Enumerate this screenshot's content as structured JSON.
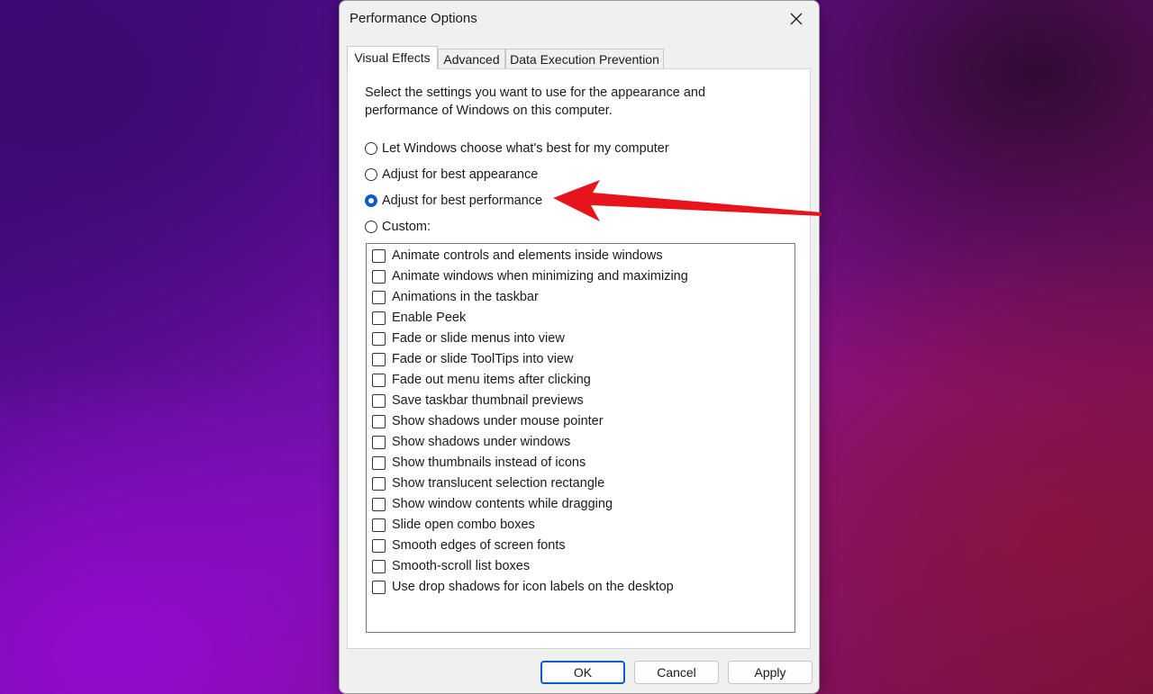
{
  "dialog": {
    "title": "Performance Options",
    "close_icon": "close-icon"
  },
  "tabs": [
    {
      "label": "Visual Effects",
      "active": true
    },
    {
      "label": "Advanced",
      "active": false
    },
    {
      "label": "Data Execution Prevention",
      "active": false
    }
  ],
  "visual_effects": {
    "intro": "Select the settings you want to use for the appearance and performance of Windows on this computer.",
    "options": [
      {
        "label": "Let Windows choose what's best for my computer",
        "checked": false
      },
      {
        "label": "Adjust for best appearance",
        "checked": false
      },
      {
        "label": "Adjust for best performance",
        "checked": true
      },
      {
        "label": "Custom:",
        "checked": false
      }
    ],
    "effects": [
      {
        "label": "Animate controls and elements inside windows",
        "checked": false
      },
      {
        "label": "Animate windows when minimizing and maximizing",
        "checked": false
      },
      {
        "label": "Animations in the taskbar",
        "checked": false
      },
      {
        "label": "Enable Peek",
        "checked": false
      },
      {
        "label": "Fade or slide menus into view",
        "checked": false
      },
      {
        "label": "Fade or slide ToolTips into view",
        "checked": false
      },
      {
        "label": "Fade out menu items after clicking",
        "checked": false
      },
      {
        "label": "Save taskbar thumbnail previews",
        "checked": false
      },
      {
        "label": "Show shadows under mouse pointer",
        "checked": false
      },
      {
        "label": "Show shadows under windows",
        "checked": false
      },
      {
        "label": "Show thumbnails instead of icons",
        "checked": false
      },
      {
        "label": "Show translucent selection rectangle",
        "checked": false
      },
      {
        "label": "Show window contents while dragging",
        "checked": false
      },
      {
        "label": "Slide open combo boxes",
        "checked": false
      },
      {
        "label": "Smooth edges of screen fonts",
        "checked": false
      },
      {
        "label": "Smooth-scroll list boxes",
        "checked": false
      },
      {
        "label": "Use drop shadows for icon labels on the desktop",
        "checked": false
      }
    ]
  },
  "buttons": {
    "ok": "OK",
    "cancel": "Cancel",
    "apply": "Apply"
  },
  "colors": {
    "accent": "#0b5cc8",
    "annotation_arrow": "#e8141c"
  }
}
